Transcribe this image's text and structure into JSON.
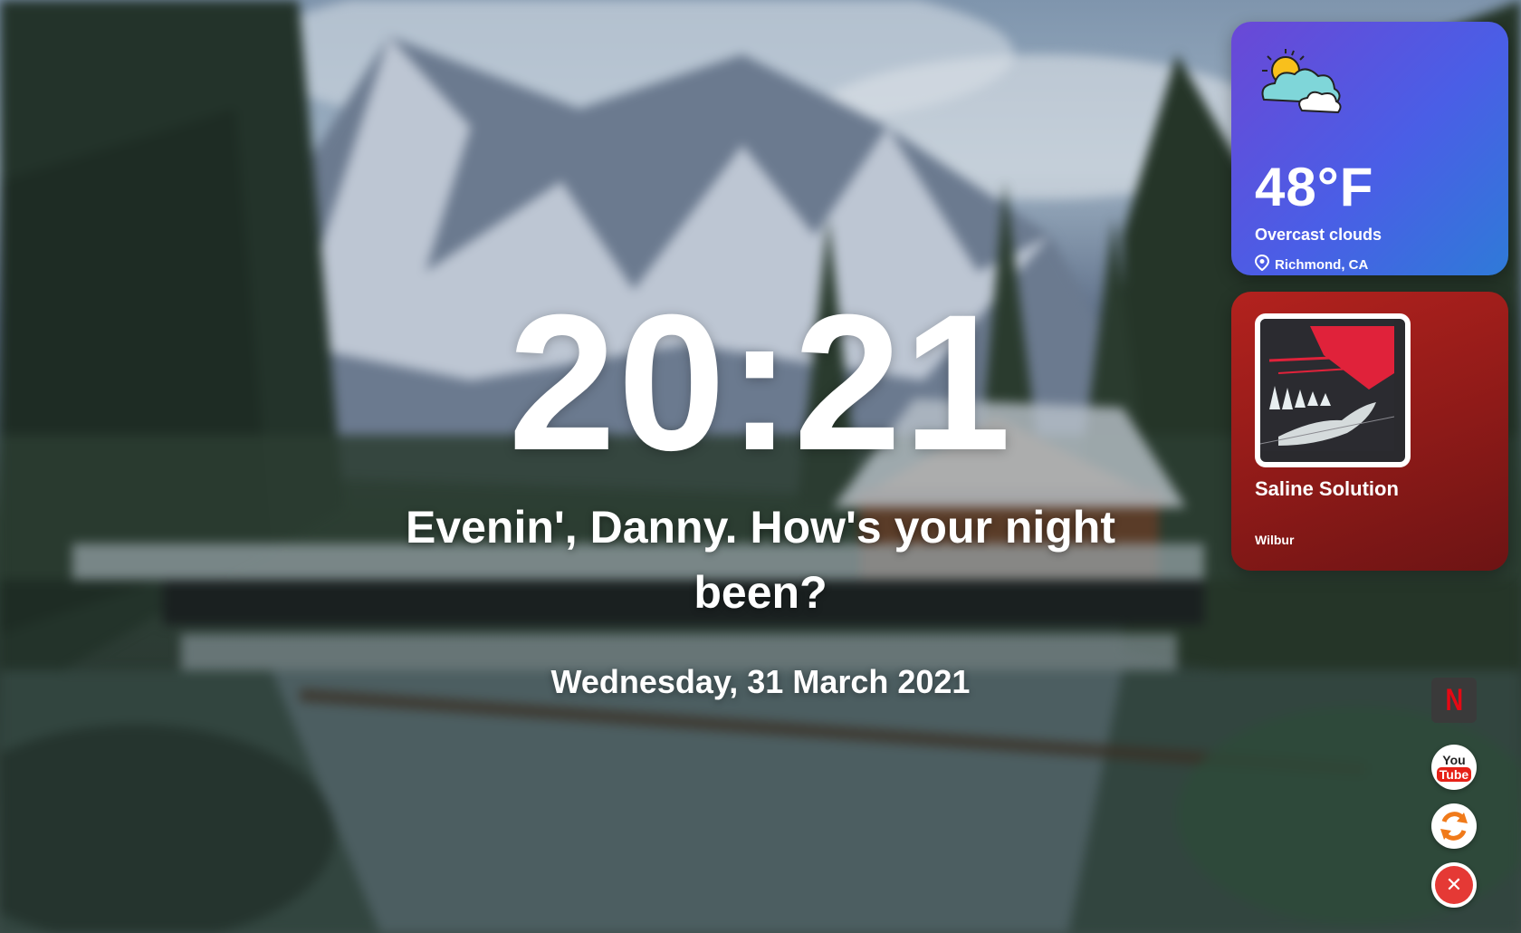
{
  "clock": {
    "time": "20:21"
  },
  "greeting": {
    "text": "Evenin', Danny. How's your night been?"
  },
  "date": {
    "text": "Wednesday, 31 March 2021"
  },
  "weather": {
    "temperature": "48°F",
    "condition": "Overcast clouds",
    "location": "Richmond, CA",
    "icon": "partly-cloudy-icon",
    "colors": {
      "gradient_start": "#6a48d6",
      "gradient_end": "#2f7ad8"
    }
  },
  "music": {
    "title": "Saline Solution",
    "artist": "Wilbur",
    "icon": "album-art",
    "colors": {
      "card": "#9e1f1c"
    }
  },
  "shortcuts": [
    {
      "name": "netflix",
      "icon": "netflix-icon",
      "glyph": "N"
    },
    {
      "name": "youtube",
      "icon": "youtube-icon",
      "top": "You",
      "bottom": "Tube"
    },
    {
      "name": "refresh",
      "icon": "refresh-icon"
    },
    {
      "name": "close",
      "icon": "close-icon",
      "glyph": "✕"
    }
  ]
}
